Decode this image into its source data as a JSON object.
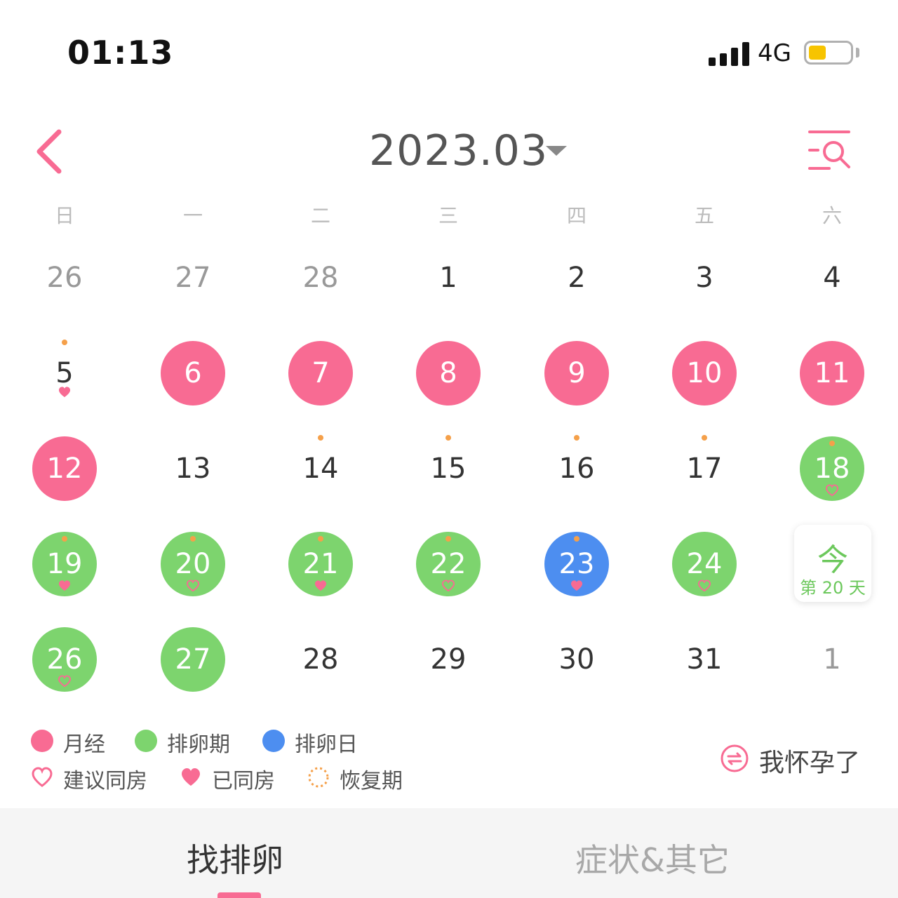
{
  "status_bar": {
    "time": "01:13",
    "network": "4G",
    "battery_level": 0.25,
    "battery_color": "#f7c400"
  },
  "header": {
    "month": "2023.03",
    "back_icon": "chevron-left-icon",
    "search_icon": "search-list-icon",
    "accent": "#f86b93"
  },
  "weekdays": [
    "日",
    "一",
    "二",
    "三",
    "四",
    "五",
    "六"
  ],
  "calendar": {
    "colors": {
      "period": "#f86b93",
      "fertile": "#7dd46e",
      "ovulation": "#4d8ef0",
      "dot": "#f5a04a",
      "heart": "#f86b93"
    },
    "weeks": [
      [
        {
          "day": "26",
          "other": true
        },
        {
          "day": "27",
          "other": true
        },
        {
          "day": "28",
          "other": true
        },
        {
          "day": "1"
        },
        {
          "day": "2"
        },
        {
          "day": "3"
        },
        {
          "day": "4"
        }
      ],
      [
        {
          "day": "5",
          "dot": true,
          "heart": "filled"
        },
        {
          "day": "6",
          "type": "period"
        },
        {
          "day": "7",
          "type": "period"
        },
        {
          "day": "8",
          "type": "period"
        },
        {
          "day": "9",
          "type": "period"
        },
        {
          "day": "10",
          "type": "period"
        },
        {
          "day": "11",
          "type": "period"
        }
      ],
      [
        {
          "day": "12",
          "type": "period"
        },
        {
          "day": "13"
        },
        {
          "day": "14",
          "dot": true
        },
        {
          "day": "15",
          "dot": true
        },
        {
          "day": "16",
          "dot": true
        },
        {
          "day": "17",
          "dot": true
        },
        {
          "day": "18",
          "type": "fertile",
          "dot": true,
          "heart": "outline"
        }
      ],
      [
        {
          "day": "19",
          "type": "fertile",
          "dot": true,
          "heart": "filled"
        },
        {
          "day": "20",
          "type": "fertile",
          "dot": true,
          "heart": "outline"
        },
        {
          "day": "21",
          "type": "fertile",
          "dot": true,
          "heart": "filled"
        },
        {
          "day": "22",
          "type": "fertile",
          "dot": true,
          "heart": "outline"
        },
        {
          "day": "23",
          "type": "ovulation",
          "dot": true,
          "heart": "filled"
        },
        {
          "day": "24",
          "type": "fertile",
          "heart": "outline"
        },
        {
          "today": true
        }
      ],
      [
        {
          "day": "26",
          "type": "fertile",
          "heart": "outline"
        },
        {
          "day": "27",
          "type": "fertile"
        },
        {
          "day": "28"
        },
        {
          "day": "29"
        },
        {
          "day": "30"
        },
        {
          "day": "31"
        },
        {
          "day": "1",
          "other": true
        }
      ]
    ],
    "today": {
      "char": "今",
      "label": "第 20 天"
    }
  },
  "legend": {
    "period": "月经",
    "fertile": "排卵期",
    "ovulation": "排卵日",
    "suggest": "建议同房",
    "done": "已同房",
    "recovery": "恢复期"
  },
  "pregnant_button": "我怀孕了",
  "tabs": [
    {
      "label": "找排卵",
      "active": true
    },
    {
      "label": "症状&其它",
      "active": false
    }
  ]
}
